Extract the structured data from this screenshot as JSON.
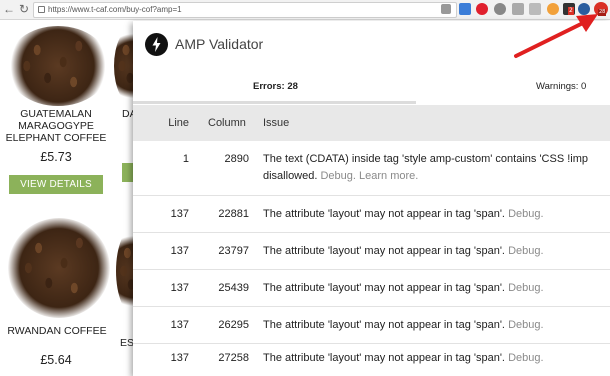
{
  "browser": {
    "url": "https://www.t-caf.com/buy-cof?amp=1",
    "ext_badges": {
      "badge_a": "2",
      "badge_b": "28"
    }
  },
  "page": {
    "products": [
      {
        "name": "GUATEMALAN MARAGOGYPE ELEPHANT COFFEE",
        "price": "£5.73",
        "button": "VIEW DETAILS"
      },
      {
        "name": "RWANDAN COFFEE",
        "price": "£5.64"
      }
    ],
    "partial_texts": {
      "da": "DA",
      "es": "ES"
    }
  },
  "popup": {
    "title": "AMP Validator",
    "tabs": {
      "errors": "Errors: 28",
      "warnings": "Warnings: 0"
    },
    "columns": {
      "line": "Line",
      "column": "Column",
      "issue": "Issue"
    },
    "rows": [
      {
        "line": "1",
        "column": "2890",
        "issue": "The text (CDATA) inside tag 'style amp-custom' contains 'CSS !imp",
        "issue_cont": "disallowed.",
        "debug": "Debug.",
        "learn": "Learn more."
      },
      {
        "line": "137",
        "column": "22881",
        "issue": "The attribute 'layout' may not appear in tag 'span'.",
        "debug": "Debug."
      },
      {
        "line": "137",
        "column": "23797",
        "issue": "The attribute 'layout' may not appear in tag 'span'.",
        "debug": "Debug."
      },
      {
        "line": "137",
        "column": "25439",
        "issue": "The attribute 'layout' may not appear in tag 'span'.",
        "debug": "Debug."
      },
      {
        "line": "137",
        "column": "26295",
        "issue": "The attribute 'layout' may not appear in tag 'span'.",
        "debug": "Debug."
      },
      {
        "line": "137",
        "column": "27258",
        "issue": "The attribute 'layout' may not appear in tag 'span'.",
        "debug": "Debug."
      }
    ]
  },
  "icons": [
    "back-icon",
    "forward-icon",
    "reload-icon",
    "lock-icon",
    "amp-bolt-icon",
    "arrow-icon",
    "amp-validator-extension-icon"
  ],
  "colors": {
    "view_button": "#8cb25a",
    "arrow": "#e02020",
    "extension_red": "#d93025",
    "table_header": "#e8e8e8"
  }
}
